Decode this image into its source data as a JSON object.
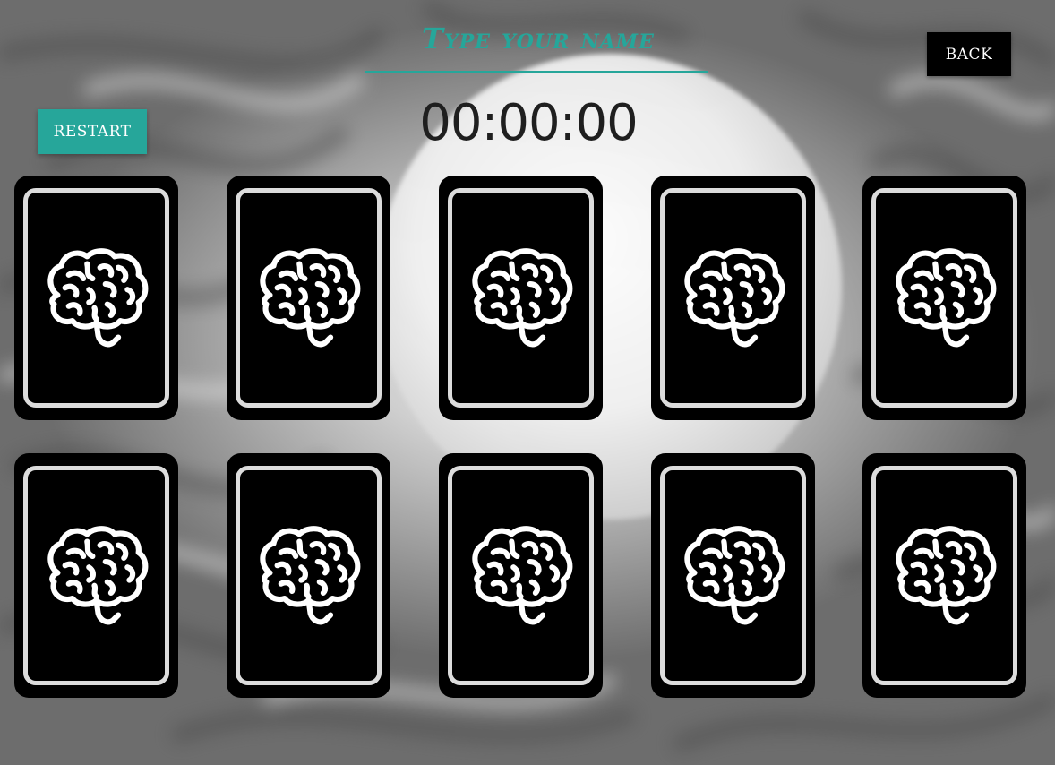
{
  "header": {
    "name_placeholder": "Type your name",
    "name_value": "",
    "back_label": "BACK"
  },
  "controls": {
    "restart_label": "RESTART"
  },
  "timer": {
    "value": "00:00:00"
  },
  "board": {
    "rows": 2,
    "columns": 5,
    "card_back_icon": "brain-icon",
    "cards": [
      {
        "state": "face-down"
      },
      {
        "state": "face-down"
      },
      {
        "state": "face-down"
      },
      {
        "state": "face-down"
      },
      {
        "state": "face-down"
      },
      {
        "state": "face-down"
      },
      {
        "state": "face-down"
      },
      {
        "state": "face-down"
      },
      {
        "state": "face-down"
      },
      {
        "state": "face-down"
      }
    ]
  },
  "colors": {
    "accent": "#26a69a",
    "card_back": "#000000",
    "card_border": "#dcdcdc",
    "back_button": "#000000"
  }
}
